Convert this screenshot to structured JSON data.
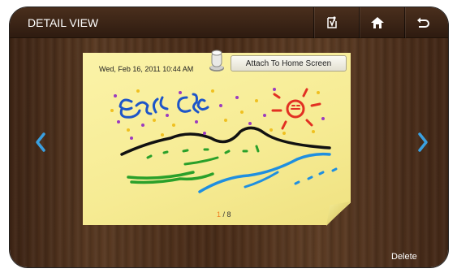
{
  "header": {
    "title": "DETAIL VIEW",
    "buttons": [
      {
        "name": "memo-attach-icon"
      },
      {
        "name": "home-icon"
      },
      {
        "name": "back-icon"
      }
    ]
  },
  "note": {
    "date": "Wed, Feb 16, 2011 10:44 AM",
    "attach_label": "Attach To Home Screen",
    "current_page": "1",
    "page_separator": " / ",
    "total_pages": "8"
  },
  "footer": {
    "delete_label": "Delete"
  },
  "colors": {
    "wood_dark": "#3e2414",
    "note_yellow": "#fbf3a8",
    "nav_arrow": "#3aa0e0",
    "page_current": "#f08020"
  }
}
